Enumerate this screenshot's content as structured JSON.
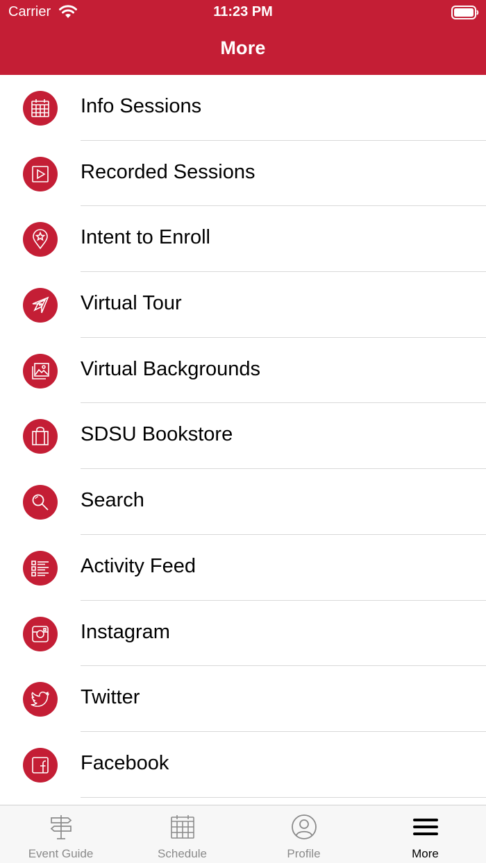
{
  "status_bar": {
    "carrier": "Carrier",
    "time": "11:23 PM"
  },
  "nav": {
    "title": "More"
  },
  "menu": [
    {
      "label": "Info Sessions",
      "icon": "calendar-icon"
    },
    {
      "label": "Recorded Sessions",
      "icon": "play-icon"
    },
    {
      "label": "Intent to Enroll",
      "icon": "map-pin-star-icon"
    },
    {
      "label": "Virtual Tour",
      "icon": "compass-icon"
    },
    {
      "label": "Virtual Backgrounds",
      "icon": "images-icon"
    },
    {
      "label": "SDSU Bookstore",
      "icon": "shopping-bag-icon"
    },
    {
      "label": "Search",
      "icon": "search-icon"
    },
    {
      "label": "Activity Feed",
      "icon": "list-icon"
    },
    {
      "label": "Instagram",
      "icon": "instagram-icon"
    },
    {
      "label": "Twitter",
      "icon": "twitter-icon"
    },
    {
      "label": "Facebook",
      "icon": "facebook-icon"
    }
  ],
  "tabs": [
    {
      "label": "Event Guide",
      "icon": "signpost-icon",
      "active": false
    },
    {
      "label": "Schedule",
      "icon": "calendar-icon",
      "active": false
    },
    {
      "label": "Profile",
      "icon": "profile-icon",
      "active": false
    },
    {
      "label": "More",
      "icon": "hamburger-menu-icon",
      "active": true
    }
  ],
  "colors": {
    "accent": "#c41e35",
    "tab_inactive": "#8a8a8a",
    "tab_active": "#000000"
  }
}
